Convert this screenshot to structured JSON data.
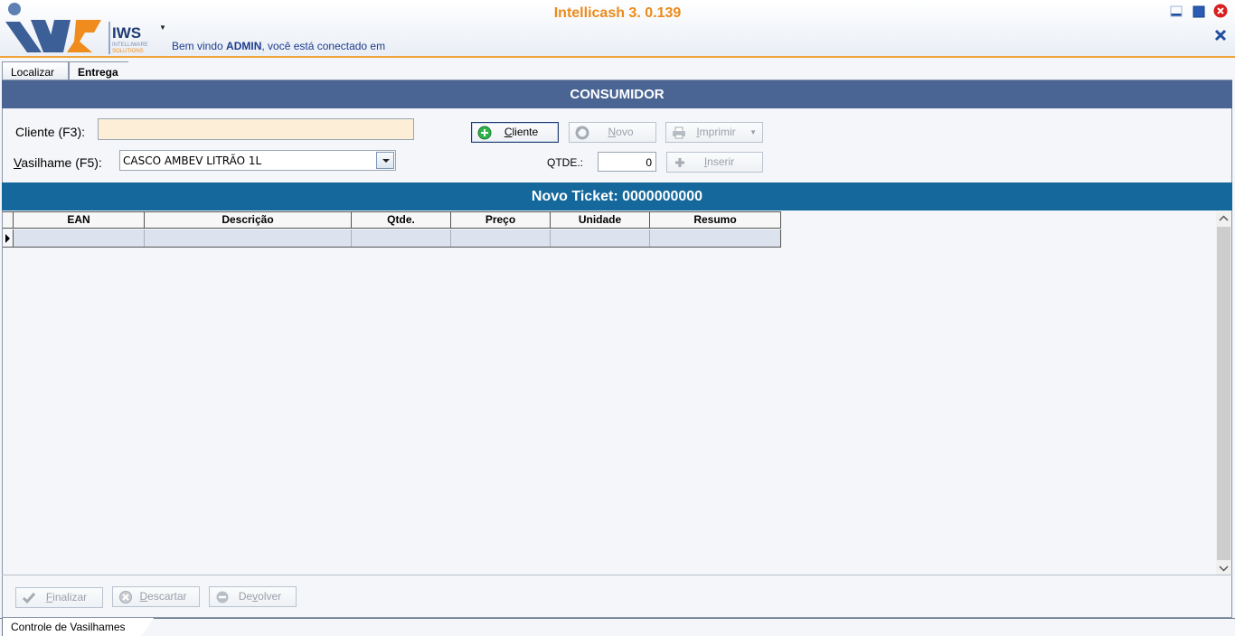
{
  "app": {
    "title": "Intellicash 3. 0.139",
    "brand": "IWS",
    "brand_sub1": "INTELLIWARE",
    "brand_sub2": "SOLUTIONS",
    "welcome_prefix": "Bem vindo ",
    "welcome_user": "ADMIN",
    "welcome_suffix": ", você está conectado em"
  },
  "tabs": [
    {
      "label": "Localizar",
      "active": false
    },
    {
      "label": "Entrega",
      "active": true
    }
  ],
  "consumidor": {
    "header": "CONSUMIDOR",
    "cliente_label": "Cliente (F3):",
    "cliente_value": "",
    "vasilhame_label_u": "V",
    "vasilhame_label_rest": "asilhame (F5):",
    "vasilhame_value": "CASCO AMBEV LITRÃO 1L",
    "qtde_label": "QTDE.:",
    "qtde_value": "0"
  },
  "buttons": {
    "cliente_u": "C",
    "cliente_rest": "liente",
    "novo_u": "N",
    "novo_rest": "ovo",
    "imprimir_u": "I",
    "imprimir_rest": "mprimir",
    "inserir_u": "I",
    "inserir_rest": "nserir",
    "finalizar_u": "F",
    "finalizar_rest": "inalizar",
    "descartar_u": "D",
    "descartar_rest": "escartar",
    "devolver_pre": "De",
    "devolver_u": "v",
    "devolver_rest": "olver"
  },
  "ticket": {
    "header": "Novo Ticket: 0000000000"
  },
  "grid": {
    "columns": [
      "EAN",
      "Descrição",
      "Qtde.",
      "Preço",
      "Unidade",
      "Resumo"
    ],
    "rows": [
      [
        "",
        "",
        "",
        "",
        "",
        ""
      ]
    ]
  },
  "footer": {
    "doc_tab": "Controle de Vasilhames"
  },
  "colors": {
    "accent_orange": "#ec8a1a",
    "consumidor_bar": "#4a6593",
    "ticket_bar": "#14689c"
  }
}
